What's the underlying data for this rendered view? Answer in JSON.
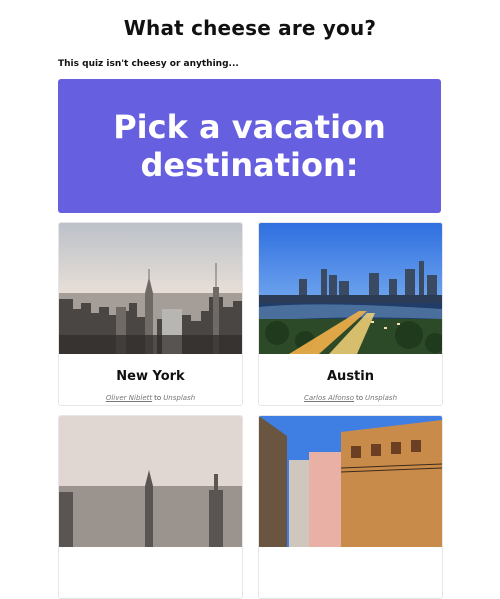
{
  "page": {
    "title": "What cheese are you?",
    "subtitle": "This quiz isn't cheesy or anything..."
  },
  "question": {
    "line1": "Pick a vacation",
    "line2": "destination:"
  },
  "options": [
    {
      "label": "New York",
      "credit_author": "Oliver Niblett",
      "credit_sep": "to",
      "credit_source": "Unsplash"
    },
    {
      "label": "Austin",
      "credit_author": "Carlos Alfonso",
      "credit_sep": "to",
      "credit_source": "Unsplash"
    }
  ],
  "colors": {
    "accent": "#6660e0",
    "text": "#111111",
    "muted": "#777777"
  }
}
